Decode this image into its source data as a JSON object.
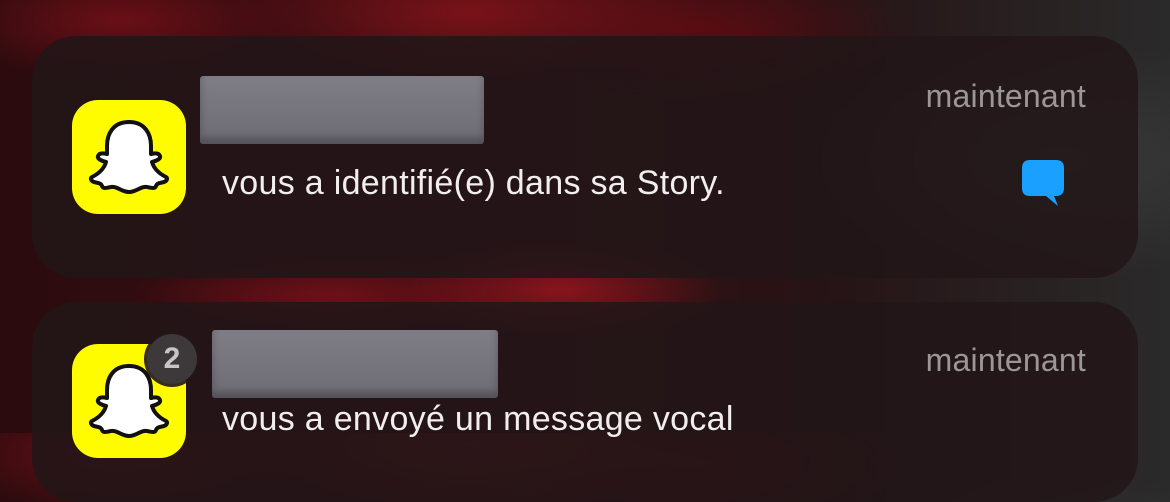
{
  "notifications": [
    {
      "app": "Snapchat",
      "sender": "",
      "timestamp": "maintenant",
      "message": "vous a identifié(e) dans sa Story.",
      "icon": "chat-bubble-icon",
      "accent": "#1aa1ff"
    },
    {
      "app": "Snapchat",
      "sender": "",
      "timestamp": "maintenant",
      "message": "vous a envoyé un message vocal",
      "stack_count": "2"
    }
  ],
  "colors": {
    "snapchat_yellow": "#fffc00",
    "chat_blue": "#1aa1ff"
  }
}
